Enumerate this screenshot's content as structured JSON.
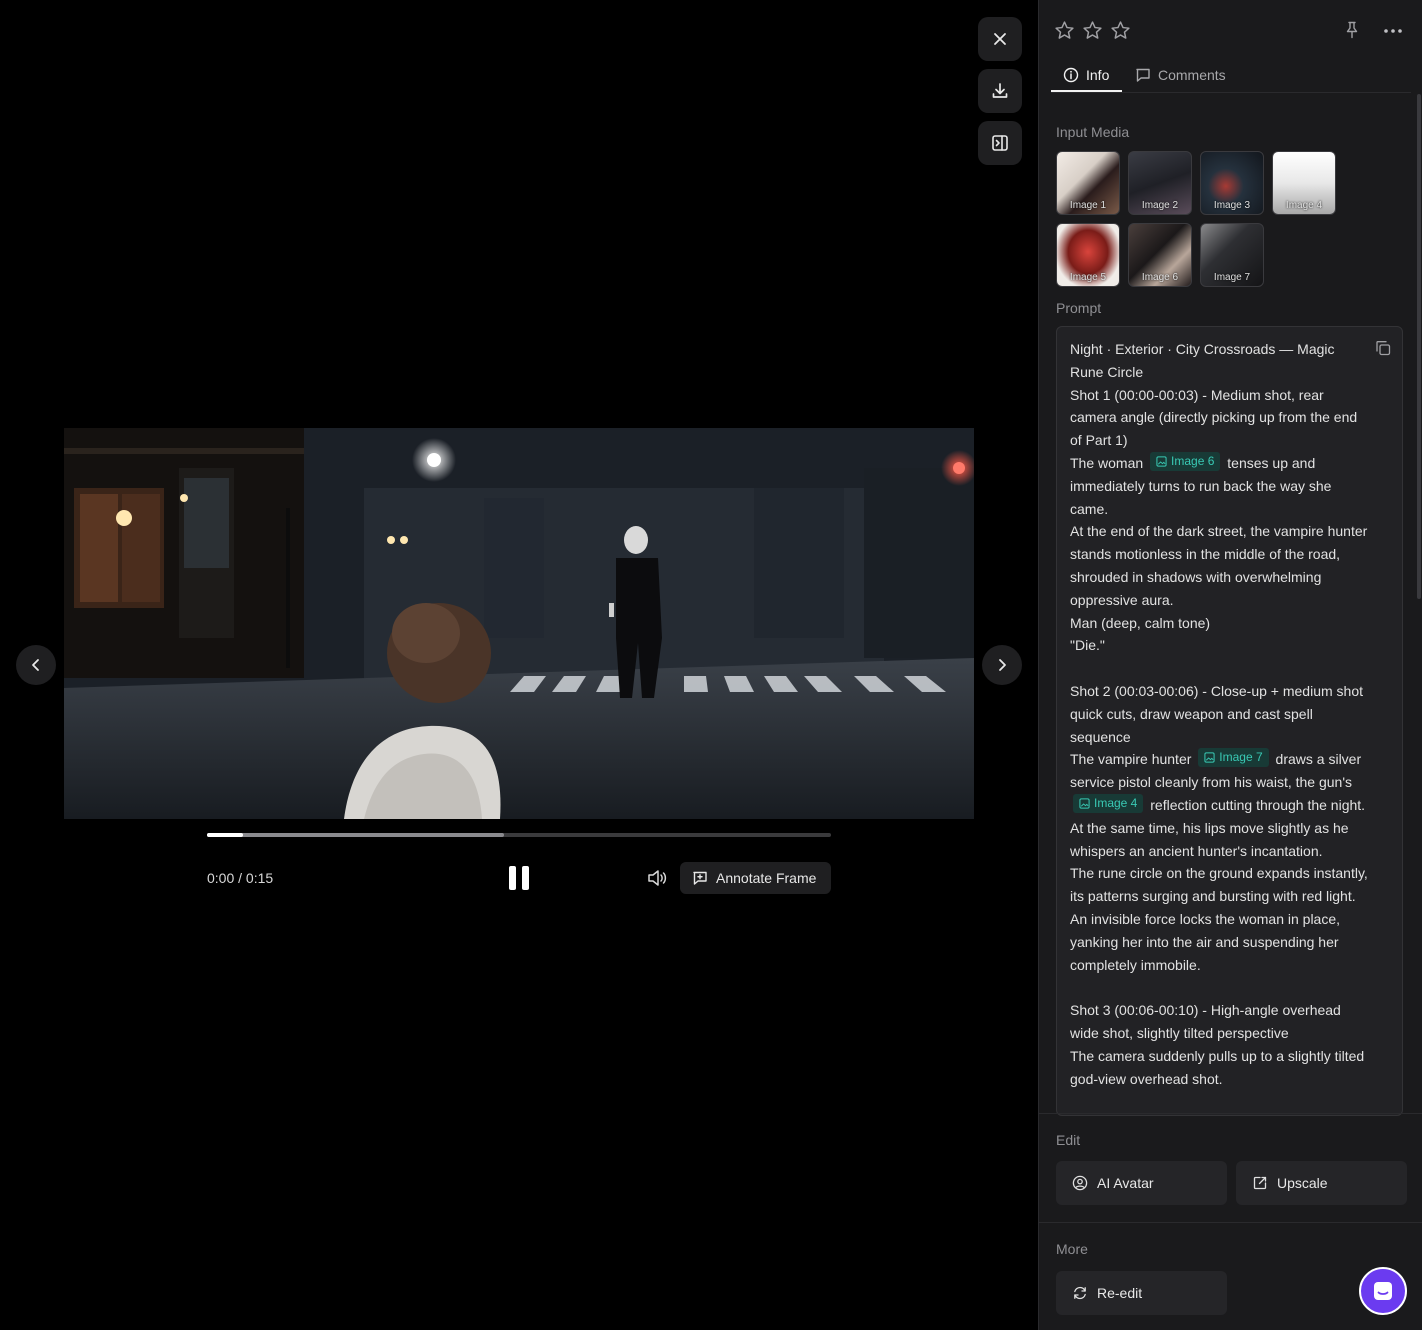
{
  "viewer": {
    "close_icon": "close-icon",
    "download_icon": "download-icon",
    "panel_toggle_icon": "panel-toggle-icon",
    "prev_icon": "chevron-left-icon",
    "next_icon": "chevron-right-icon"
  },
  "player": {
    "time": "0:00 / 0:15",
    "played_fraction": 0.057,
    "buffered_fraction": 0.476,
    "annotate_label": "Annotate Frame",
    "state": "playing"
  },
  "panel": {
    "rating": {
      "max": 5,
      "shown": 3,
      "value": 0
    },
    "tabs": [
      {
        "label": "Info",
        "active": true
      },
      {
        "label": "Comments",
        "active": false
      }
    ],
    "input_media_label": "Input Media",
    "input_media": [
      {
        "label": "Image 1"
      },
      {
        "label": "Image 2"
      },
      {
        "label": "Image 3"
      },
      {
        "label": "Image 4"
      },
      {
        "label": "Image 5"
      },
      {
        "label": "Image 6"
      },
      {
        "label": "Image 7"
      }
    ],
    "prompt_label": "Prompt",
    "prompt": {
      "title": "Night · Exterior · City Crossroads — Magic Rune Circle",
      "shot1_heading": "Shot 1 (00:00-00:03) - Medium shot, rear camera angle (directly picking up from the end of Part 1)",
      "shot1_a_pre": "The woman",
      "shot1_a_chip": "Image 6",
      "shot1_a_post": "tenses up and immediately turns to run back the way she came.",
      "shot1_b": "At the end of the dark street, the vampire hunter stands motionless in the middle of the road, shrouded in shadows with overwhelming oppressive aura.",
      "shot1_c": "Man (deep, calm tone)",
      "shot1_d": "\"Die.\"",
      "shot2_heading": "Shot 2 (00:03-00:06) - Close-up + medium shot quick cuts, draw weapon and cast spell sequence",
      "shot2_a_pre": "The vampire hunter",
      "shot2_a_chip": "Image 7",
      "shot2_a_mid": "draws a silver service pistol cleanly from his waist, the gun's",
      "shot2_a_chip2": "Image 4",
      "shot2_a_post": "reflection cutting through the night. At the same time, his lips move slightly as he whispers an ancient hunter's incantation.",
      "shot2_b": "The rune circle on the ground expands instantly, its patterns surging and bursting with red light. An invisible force locks the woman in place, yanking her into the air and suspending her completely immobile.",
      "shot3_heading": "Shot 3 (00:06-00:10) - High-angle overhead wide shot, slightly tilted perspective",
      "shot3_a": "The camera suddenly pulls up to a slightly tilted god-view overhead shot."
    },
    "edit_label": "Edit",
    "edit_actions": [
      {
        "label": "AI Avatar",
        "icon": "avatar-icon"
      },
      {
        "label": "Upscale",
        "icon": "upscale-icon"
      }
    ],
    "more_label": "More",
    "more_actions": [
      {
        "label": "Re-edit",
        "icon": "refresh-icon"
      }
    ]
  },
  "colors": {
    "accent_chip_bg": "#183a36",
    "accent_chip_text": "#39c9b4",
    "chat_launcher": "#6b3bf0"
  }
}
